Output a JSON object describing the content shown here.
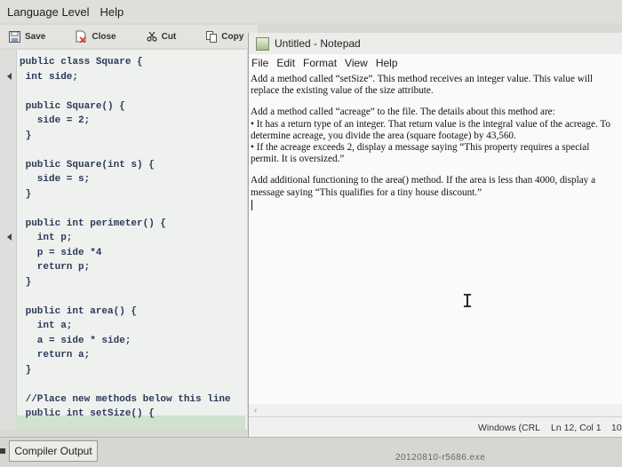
{
  "ide": {
    "menu": [
      "Language Level",
      "Help"
    ],
    "toolbar": {
      "save": "Save",
      "close": "Close",
      "cut": "Cut",
      "copy": "Copy"
    },
    "code_lines": [
      "public class Square {",
      " int side;",
      "",
      " public Square() {",
      "   side = 2;",
      " }",
      "",
      " public Square(int s) {",
      "   side = s;",
      " }",
      "",
      " public int perimeter() {",
      "   int p;",
      "   p = side *4",
      "   return p;",
      " }",
      "",
      " public int area() {",
      "   int a;",
      "   a = side * side;",
      "   return a;",
      " }",
      "",
      " //Place new methods below this line",
      " public int setSize() {"
    ],
    "compiler_output_tab": "Compiler Output",
    "taskbar_faded": "20120810-r5686.exe"
  },
  "notepad": {
    "title": "Untitled - Notepad",
    "menu": [
      "File",
      "Edit",
      "Format",
      "View",
      "Help"
    ],
    "paragraphs": [
      "Add a method called “setSize”. This method receives an integer value. This value will replace the existing value of the size attribute.",
      "Add a method called “acreage” to the file. The details about this method are:\n• It has a return type of an integer. That return value is the integral value of the acreage. To determine acreage, you divide the area (square footage) by 43,560.\n• If the acreage exceeds 2, display a message saying “This property requires a special permit. It is oversized.”",
      "Add additional functioning to the area() method. If the area is less than 4000, display a message saying “This qualifies for a tiny house discount.”"
    ],
    "status": {
      "encoding": "Windows (CRL",
      "position": "Ln 12, Col 1",
      "zoom": "10"
    }
  }
}
